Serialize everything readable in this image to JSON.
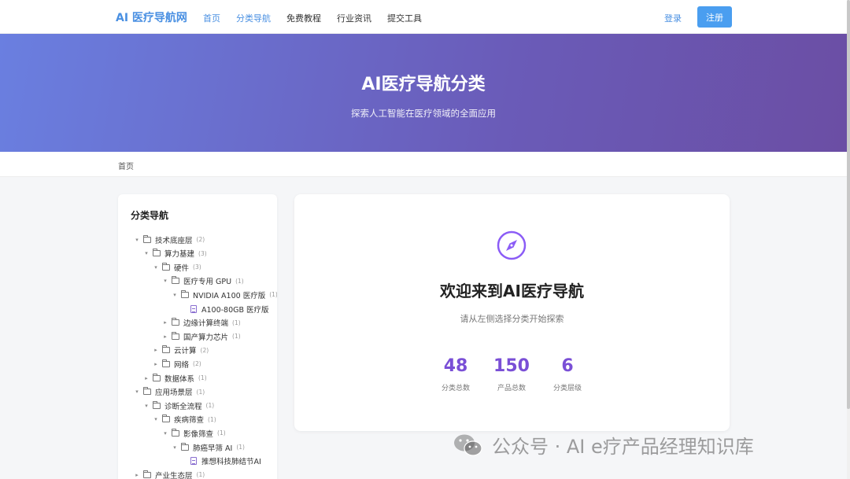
{
  "header": {
    "brand": "AI 医疗导航网",
    "nav": [
      {
        "label": "首页",
        "active": true
      },
      {
        "label": "分类导航",
        "active": true
      },
      {
        "label": "免费教程",
        "active": false
      },
      {
        "label": "行业资讯",
        "active": false
      },
      {
        "label": "提交工具",
        "active": false
      }
    ],
    "login": "登录",
    "register": "注册"
  },
  "hero": {
    "title": "AI医疗导航分类",
    "subtitle": "探索人工智能在医疗领域的全面应用"
  },
  "breadcrumb": "首页",
  "sidebar": {
    "title": "分类导航",
    "tree": [
      {
        "label": "技术底座层",
        "count": "(2)",
        "type": "folder",
        "level": 0,
        "caret": "down"
      },
      {
        "label": "算力基建",
        "count": "(3)",
        "type": "folder",
        "level": 1,
        "caret": "down"
      },
      {
        "label": "硬件",
        "count": "(3)",
        "type": "folder",
        "level": 2,
        "caret": "down"
      },
      {
        "label": "医疗专用 GPU",
        "count": "(1)",
        "type": "folder",
        "level": 3,
        "caret": "down"
      },
      {
        "label": "NVIDIA A100 医疗版",
        "count": "(1)",
        "type": "folder",
        "level": 4,
        "caret": "down"
      },
      {
        "label": "A100-80GB 医疗版",
        "count": "",
        "type": "file",
        "level": 5,
        "caret": ""
      },
      {
        "label": "边缘计算终端",
        "count": "(1)",
        "type": "folder",
        "level": 3,
        "caret": "right"
      },
      {
        "label": "国产算力芯片",
        "count": "(1)",
        "type": "folder",
        "level": 3,
        "caret": "right"
      },
      {
        "label": "云计算",
        "count": "(2)",
        "type": "folder",
        "level": 2,
        "caret": "right"
      },
      {
        "label": "网络",
        "count": "(2)",
        "type": "folder",
        "level": 2,
        "caret": "right"
      },
      {
        "label": "数据体系",
        "count": "(1)",
        "type": "folder",
        "level": 1,
        "caret": "right"
      },
      {
        "label": "应用场景层",
        "count": "(1)",
        "type": "folder",
        "level": 0,
        "caret": "down"
      },
      {
        "label": "诊断全流程",
        "count": "(1)",
        "type": "folder",
        "level": 1,
        "caret": "down"
      },
      {
        "label": "疾病筛查",
        "count": "(1)",
        "type": "folder",
        "level": 2,
        "caret": "down"
      },
      {
        "label": "影像筛查",
        "count": "(1)",
        "type": "folder",
        "level": 3,
        "caret": "down"
      },
      {
        "label": "肺癌早筛 AI",
        "count": "(1)",
        "type": "folder",
        "level": 4,
        "caret": "down"
      },
      {
        "label": "推想科技肺结节AI",
        "count": "",
        "type": "file",
        "level": 5,
        "caret": ""
      },
      {
        "label": "产业生态层",
        "count": "(1)",
        "type": "folder",
        "level": 0,
        "caret": "right"
      }
    ]
  },
  "main": {
    "icon": "compass-icon",
    "title": "欢迎来到AI医疗导航",
    "subtitle": "请从左侧选择分类开始探索",
    "stats": [
      {
        "value": "48",
        "label": "分类总数"
      },
      {
        "value": "150",
        "label": "产品总数"
      },
      {
        "value": "6",
        "label": "分类层级"
      }
    ]
  },
  "watermark": "公众号 · AI e疗产品经理知识库",
  "colors": {
    "accent": "#4a90e2",
    "stat": "#7a4fd6",
    "hero_start": "#6a7fe0",
    "hero_end": "#6b4ea4"
  }
}
